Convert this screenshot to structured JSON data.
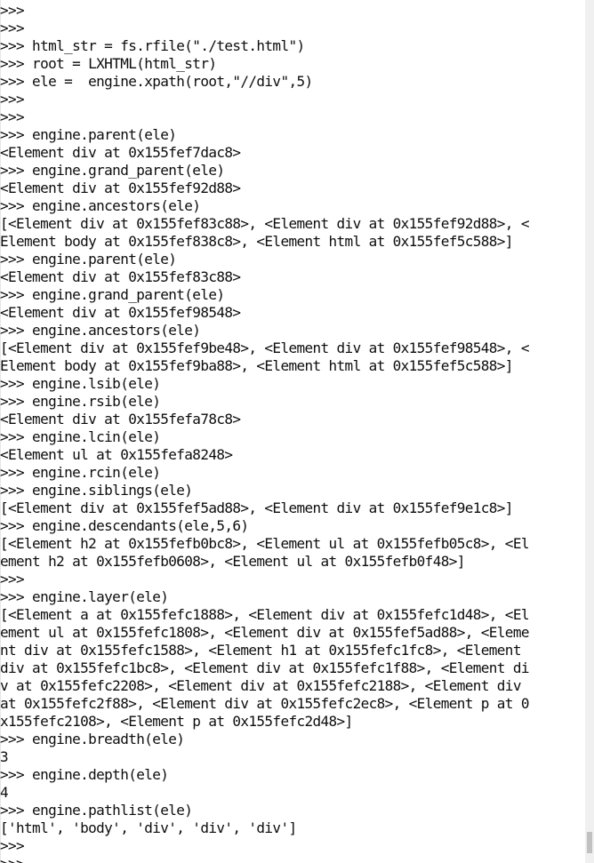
{
  "console": {
    "lines": [
      ">>>",
      ">>>",
      ">>> html_str = fs.rfile(\"./test.html\")",
      ">>> root = LXHTML(html_str)",
      ">>> ele =  engine.xpath(root,\"//div\",5)",
      ">>>",
      ">>>",
      ">>> engine.parent(ele)",
      "<Element div at 0x155fef7dac8>",
      ">>> engine.grand_parent(ele)",
      "<Element div at 0x155fef92d88>",
      ">>> engine.ancestors(ele)",
      "[<Element div at 0x155fef83c88>, <Element div at 0x155fef92d88>, <",
      "Element body at 0x155fef838c8>, <Element html at 0x155fef5c588>]",
      ">>> engine.parent(ele)",
      "<Element div at 0x155fef83c88>",
      ">>> engine.grand_parent(ele)",
      "<Element div at 0x155fef98548>",
      ">>> engine.ancestors(ele)",
      "[<Element div at 0x155fef9be48>, <Element div at 0x155fef98548>, <",
      "Element body at 0x155fef9ba88>, <Element html at 0x155fef5c588>]",
      ">>> engine.lsib(ele)",
      ">>> engine.rsib(ele)",
      "<Element div at 0x155fefa78c8>",
      ">>> engine.lcin(ele)",
      "<Element ul at 0x155fefa8248>",
      ">>> engine.rcin(ele)",
      ">>> engine.siblings(ele)",
      "[<Element div at 0x155fef5ad88>, <Element div at 0x155fef9e1c8>]",
      ">>> engine.descendants(ele,5,6)",
      "[<Element h2 at 0x155fefb0bc8>, <Element ul at 0x155fefb05c8>, <El",
      "ement h2 at 0x155fefb0608>, <Element ul at 0x155fefb0f48>]",
      ">>>",
      ">>> engine.layer(ele)",
      "[<Element a at 0x155fefc1888>, <Element div at 0x155fefc1d48>, <El",
      "ement ul at 0x155fefc1808>, <Element div at 0x155fef5ad88>, <Eleme",
      "nt div at 0x155fefc1588>, <Element h1 at 0x155fefc1fc8>, <Element ",
      "div at 0x155fefc1bc8>, <Element div at 0x155fefc1f88>, <Element di",
      "v at 0x155fefc2208>, <Element div at 0x155fefc2188>, <Element div ",
      "at 0x155fefc2f88>, <Element div at 0x155fefc2ec8>, <Element p at 0",
      "x155fefc2108>, <Element p at 0x155fefc2d48>]",
      ">>> engine.breadth(ele)",
      "3",
      ">>> engine.depth(ele)",
      "4",
      ">>> engine.pathlist(ele)",
      "['html', 'body', 'div', 'div', 'div']",
      ">>>",
      ">>>"
    ],
    "cursor_icon": "text-cursor-icon"
  }
}
